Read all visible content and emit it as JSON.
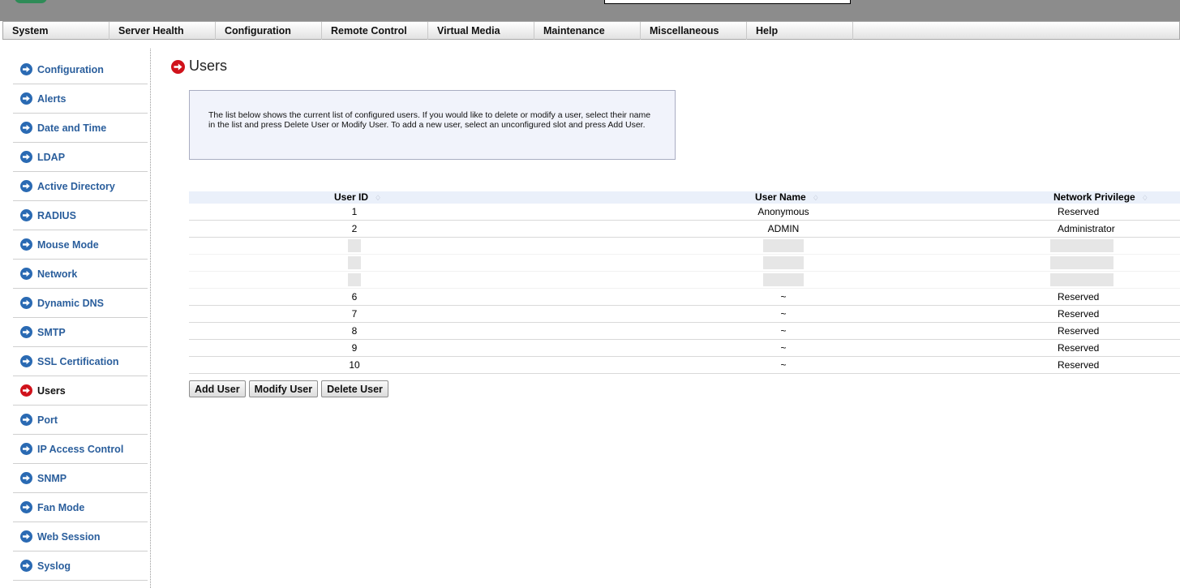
{
  "menu": [
    {
      "key": "system",
      "label": "System"
    },
    {
      "key": "server-health",
      "label": "Server Health"
    },
    {
      "key": "configuration",
      "label": "Configuration"
    },
    {
      "key": "remote-control",
      "label": "Remote Control"
    },
    {
      "key": "virtual-media",
      "label": "Virtual Media"
    },
    {
      "key": "maintenance",
      "label": "Maintenance"
    },
    {
      "key": "miscellaneous",
      "label": "Miscellaneous"
    },
    {
      "key": "help",
      "label": "Help"
    }
  ],
  "sidebar": {
    "active_item": "Users",
    "items": [
      {
        "key": "configuration",
        "label": "Configuration"
      },
      {
        "key": "alerts",
        "label": "Alerts"
      },
      {
        "key": "date-and-time",
        "label": "Date and Time"
      },
      {
        "key": "ldap",
        "label": "LDAP"
      },
      {
        "key": "active-directory",
        "label": "Active Directory"
      },
      {
        "key": "radius",
        "label": "RADIUS"
      },
      {
        "key": "mouse-mode",
        "label": "Mouse Mode"
      },
      {
        "key": "network",
        "label": "Network"
      },
      {
        "key": "dynamic-dns",
        "label": "Dynamic DNS"
      },
      {
        "key": "smtp",
        "label": "SMTP"
      },
      {
        "key": "ssl-certification",
        "label": "SSL Certification"
      },
      {
        "key": "users",
        "label": "Users"
      },
      {
        "key": "port",
        "label": "Port"
      },
      {
        "key": "ip-access-control",
        "label": "IP Access Control"
      },
      {
        "key": "snmp",
        "label": "SNMP"
      },
      {
        "key": "fan-mode",
        "label": "Fan Mode"
      },
      {
        "key": "web-session",
        "label": "Web Session"
      },
      {
        "key": "syslog",
        "label": "Syslog"
      }
    ]
  },
  "page": {
    "title": "Users",
    "info_text": "The list below shows the current list of configured users. If you would like to delete or modify a user, select their name in the list and press Delete User or Modify User. To add a new user, select an unconfigured slot and press Add User."
  },
  "table": {
    "headers": {
      "user_id": "User ID",
      "user_name": "User Name",
      "network_privilege": "Network Privilege"
    },
    "sort_glyph": "♢",
    "rows": [
      {
        "id": "1",
        "name": "Anonymous",
        "privilege": "Reserved",
        "redacted": false
      },
      {
        "id": "2",
        "name": "ADMIN",
        "privilege": "Administrator",
        "redacted": false
      },
      {
        "id": "",
        "name": "",
        "privilege": "",
        "redacted": true
      },
      {
        "id": "",
        "name": "",
        "privilege": "",
        "redacted": true
      },
      {
        "id": "",
        "name": "",
        "privilege": "",
        "redacted": true
      },
      {
        "id": "6",
        "name": "~",
        "privilege": "Reserved",
        "redacted": false
      },
      {
        "id": "7",
        "name": "~",
        "privilege": "Reserved",
        "redacted": false
      },
      {
        "id": "8",
        "name": "~",
        "privilege": "Reserved",
        "redacted": false
      },
      {
        "id": "9",
        "name": "~",
        "privilege": "Reserved",
        "redacted": false
      },
      {
        "id": "10",
        "name": "~",
        "privilege": "Reserved",
        "redacted": false
      }
    ]
  },
  "buttons": {
    "add": "Add User",
    "modify": "Modify User",
    "delete": "Delete User"
  },
  "icons": {
    "nav_arrow": "arrow-right-circle-icon",
    "active_arrow": "arrow-right-circle-icon"
  },
  "colors": {
    "nav_blue": "#2a6ab3",
    "active_red": "#d0121b",
    "link_text": "#2a5e9c"
  }
}
